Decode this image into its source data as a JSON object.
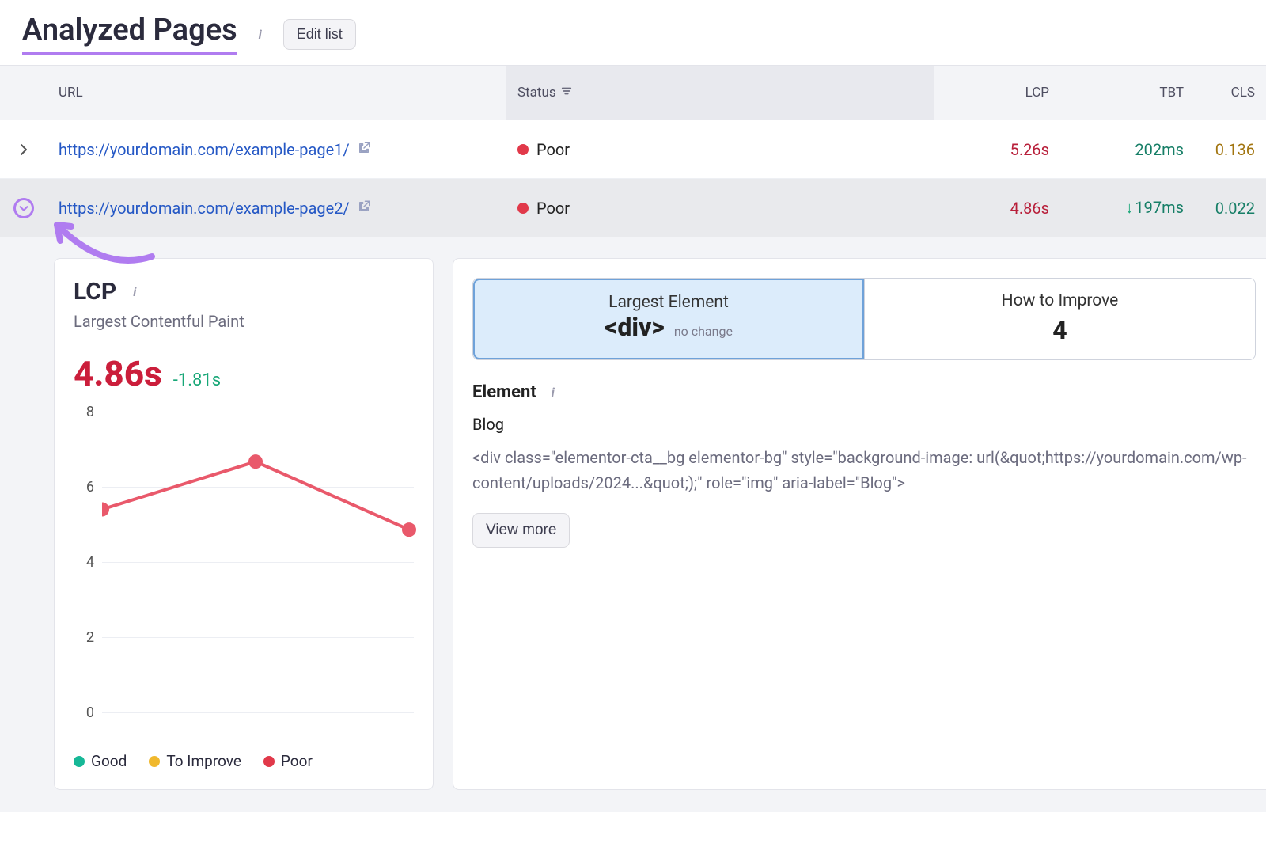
{
  "header": {
    "title": "Analyzed Pages",
    "edit_label": "Edit list"
  },
  "table": {
    "columns": {
      "url": "URL",
      "status": "Status",
      "lcp": "LCP",
      "tbt": "TBT",
      "cls": "CLS"
    },
    "rows": [
      {
        "url": "https://yourdomain.com/example-page1/",
        "status": "Poor",
        "lcp": "5.26s",
        "tbt": "202ms",
        "tbt_trend": "none",
        "cls": "0.136"
      },
      {
        "url": "https://yourdomain.com/example-page2/",
        "status": "Poor",
        "lcp": "4.86s",
        "tbt": "197ms",
        "tbt_trend": "down",
        "cls": "0.022"
      }
    ]
  },
  "lcp_panel": {
    "title": "LCP",
    "subtitle": "Largest Contentful Paint",
    "value": "4.86s",
    "delta": "-1.81s",
    "legend": {
      "good": "Good",
      "improve": "To Improve",
      "poor": "Poor"
    }
  },
  "chart_data": {
    "type": "line",
    "title": "LCP",
    "ylabel": "",
    "ylim": [
      0,
      8
    ],
    "yticks": [
      0,
      2,
      4,
      6,
      8
    ],
    "x": [
      1,
      2,
      3
    ],
    "series": [
      {
        "name": "Poor",
        "values": [
          5.4,
          6.67,
          4.86
        ],
        "color": "#e9596b"
      }
    ]
  },
  "tabs": {
    "largest": {
      "title": "Largest Element",
      "big": "<div>",
      "note": "no change"
    },
    "improve": {
      "title": "How to Improve",
      "big": "4"
    }
  },
  "element": {
    "section_title": "Element",
    "name": "Blog",
    "code": "<div class=\"elementor-cta__bg elementor-bg\" style=\"background-image: url(&quot;https://yourdomain.com/wp-content/uploads/2024...&quot;);\" role=\"img\" aria-label=\"Blog\">",
    "view_more": "View more"
  }
}
